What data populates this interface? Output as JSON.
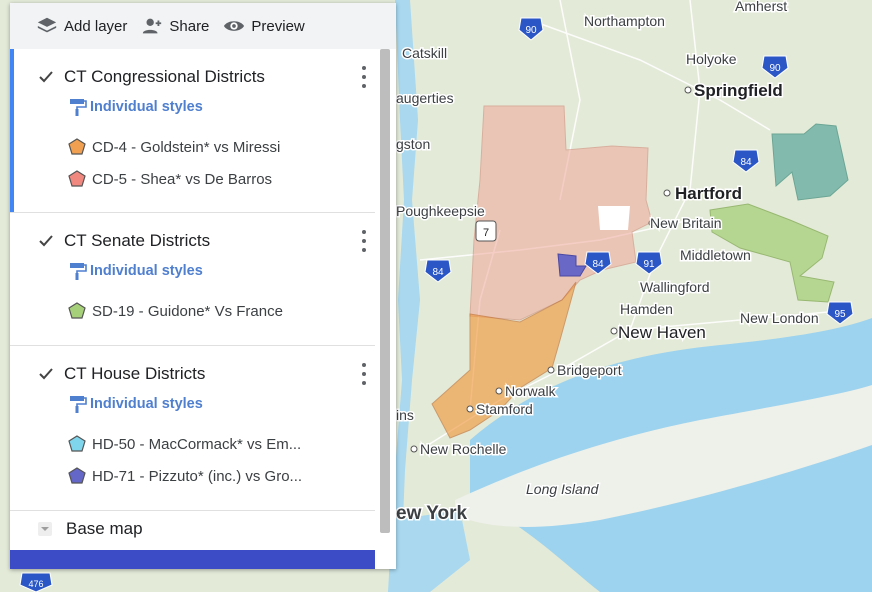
{
  "toolbar": {
    "add_layer": "Add layer",
    "share": "Share",
    "preview": "Preview"
  },
  "layers": [
    {
      "title": "CT Congressional Districts",
      "styles": "Individual styles",
      "checked": true,
      "items": [
        {
          "label": "CD-4 - Goldstein* vs Miressi",
          "color": "#f0a050"
        },
        {
          "label": "CD-5 - Shea* vs De Barros",
          "color": "#f08880"
        }
      ]
    },
    {
      "title": "CT Senate Districts",
      "styles": "Individual styles",
      "checked": true,
      "items": [
        {
          "label": "SD-19 - Guidone* Vs France",
          "color": "#a6d07a"
        }
      ]
    },
    {
      "title": "CT House Districts",
      "styles": "Individual styles",
      "checked": true,
      "items": [
        {
          "label": "HD-50 - MacCormack* vs Em...",
          "color": "#7fd6ec"
        },
        {
          "label": "HD-71 - Pizzuto* (inc.) vs Gro...",
          "color": "#6466c8"
        }
      ]
    }
  ],
  "base_map": "Base map",
  "map": {
    "cities": {
      "amherst": "Amherst",
      "northampton": "Northampton",
      "catskill": "Catskill",
      "holyoke": "Holyoke",
      "springfield": "Springfield",
      "saugerties": "augerties",
      "kingston": "gston",
      "hartford": "Hartford",
      "poughkeepsie": "Poughkeepsie",
      "new_britain": "New Britain",
      "middletown": "Middletown",
      "wallingford": "Wallingford",
      "hamden": "Hamden",
      "new_haven": "New Haven",
      "new_london": "New London",
      "bridgeport": "Bridgeport",
      "norwalk": "Norwalk",
      "stamford": "Stamford",
      "ossining": "ins",
      "new_rochelle": "New Rochelle",
      "long_island": "Long Island",
      "new_york": "ew York"
    },
    "shields": {
      "i90_west": "90",
      "i90_east": "90",
      "i84_east": "84",
      "i84_west": "84",
      "i84_mid": "84",
      "i91": "91",
      "i95": "95",
      "us7": "7",
      "i476": "476"
    }
  }
}
